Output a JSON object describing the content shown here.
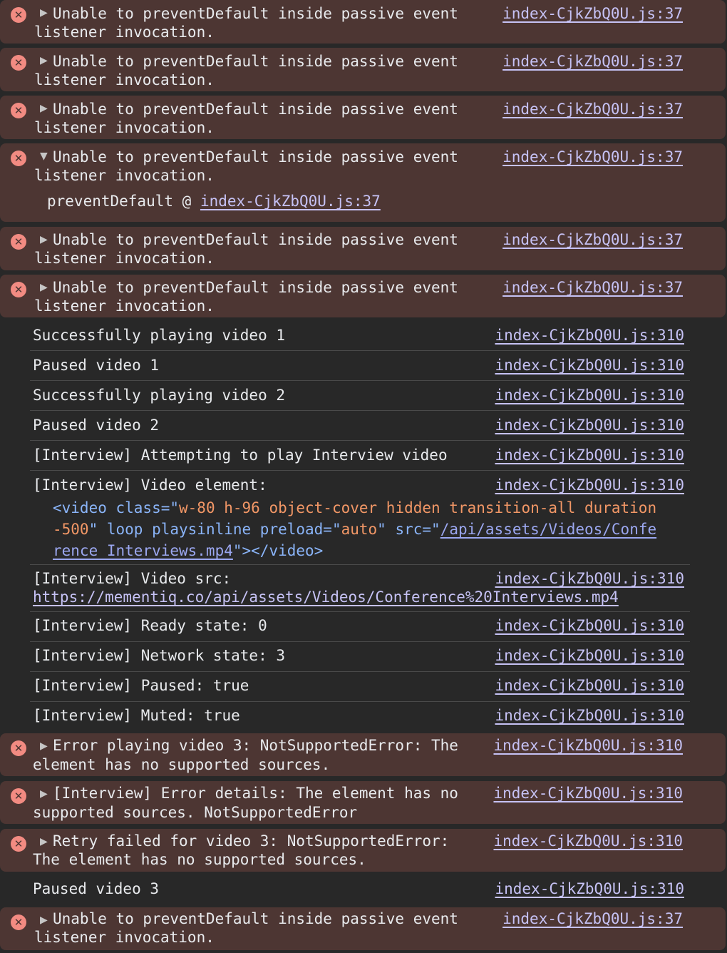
{
  "colors": {
    "error_bg": "#4d3633",
    "error_icon": "#f28b82",
    "link": "#c6c2f5",
    "text": "#e8eaed",
    "html_tag": "#8ab4f8",
    "html_value": "#f29766"
  },
  "icons": {
    "error": "error-circle-x-icon",
    "collapsed": "triangle-right-icon",
    "expanded": "triangle-down-icon"
  },
  "entries": [
    {
      "type": "error",
      "msg1": "Unable to preventDefault inside passive event",
      "msg2": "listener invocation.",
      "src": "index-CjkZbQ0U.js:37"
    },
    {
      "type": "error",
      "msg1": "Unable to preventDefault inside passive event",
      "msg2": "listener invocation.",
      "src": "index-CjkZbQ0U.js:37"
    },
    {
      "type": "error",
      "msg1": "Unable to preventDefault inside passive event",
      "msg2": "listener invocation.",
      "src": "index-CjkZbQ0U.js:37"
    },
    {
      "type": "error",
      "msg1": "Unable to preventDefault inside passive event",
      "msg2": "listener invocation.",
      "src": "index-CjkZbQ0U.js:37",
      "stack_fn": "preventDefault @ ",
      "stack_src": "index-CjkZbQ0U.js:37"
    },
    {
      "type": "error",
      "msg1": "Unable to preventDefault inside passive event",
      "msg2": "listener invocation.",
      "src": "index-CjkZbQ0U.js:37"
    },
    {
      "type": "error",
      "msg1": "Unable to preventDefault inside passive event",
      "msg2": "listener invocation.",
      "src": "index-CjkZbQ0U.js:37"
    },
    {
      "type": "log",
      "msg1": "Successfully playing video 1",
      "src": "index-CjkZbQ0U.js:310"
    },
    {
      "type": "log",
      "msg1": "Paused video 1",
      "src": "index-CjkZbQ0U.js:310"
    },
    {
      "type": "log",
      "msg1": "Successfully playing video 2",
      "src": "index-CjkZbQ0U.js:310"
    },
    {
      "type": "log",
      "msg1": "Paused video 2",
      "src": "index-CjkZbQ0U.js:310"
    },
    {
      "type": "log",
      "msg1": "[Interview] Attempting to play Interview video",
      "src": "index-CjkZbQ0U.js:310"
    },
    {
      "type": "log",
      "msg1": "[Interview] Video element:",
      "src": "index-CjkZbQ0U.js:310",
      "html": {
        "open": "<video",
        "a1": " class=\"",
        "v1a": "w-80 h-96 object-cover hidden transition-all duration",
        "v1b": "-500",
        "a2": "\" loop playsinline preload=\"",
        "v2": "auto",
        "a3": "\" src=\"",
        "url_a": "/api/assets/Videos/Confe",
        "url_b": "rence Interviews.mp4",
        "close": "\"></video>"
      }
    },
    {
      "type": "log",
      "msg1": "[Interview] Video src:",
      "src": "index-CjkZbQ0U.js:310",
      "url": "https://mementiq.co/api/assets/Videos/Conference%20Interviews.mp4"
    },
    {
      "type": "log",
      "msg1": "[Interview] Ready state: 0",
      "src": "index-CjkZbQ0U.js:310"
    },
    {
      "type": "log",
      "msg1": "[Interview] Network state: 3",
      "src": "index-CjkZbQ0U.js:310"
    },
    {
      "type": "log",
      "msg1": "[Interview] Paused: true",
      "src": "index-CjkZbQ0U.js:310"
    },
    {
      "type": "log",
      "msg1": "[Interview] Muted: true",
      "src": "index-CjkZbQ0U.js:310"
    },
    {
      "type": "error",
      "msg1": "Error playing video 3: NotSupportedError: The",
      "msg2": "element has no supported sources.",
      "src": "index-CjkZbQ0U.js:310"
    },
    {
      "type": "error",
      "msg1": "[Interview] Error details: The element has no",
      "msg2": "supported sources. NotSupportedError",
      "src": "index-CjkZbQ0U.js:310"
    },
    {
      "type": "error",
      "msg1": "Retry failed for video 3: NotSupportedError:",
      "msg2": "The element has no supported sources.",
      "src": "index-CjkZbQ0U.js:310"
    },
    {
      "type": "log",
      "msg1": "Paused video 3",
      "src": "index-CjkZbQ0U.js:310"
    },
    {
      "type": "error",
      "msg1": "Unable to preventDefault inside passive event",
      "msg2": "listener invocation.",
      "src": "index-CjkZbQ0U.js:37"
    }
  ]
}
